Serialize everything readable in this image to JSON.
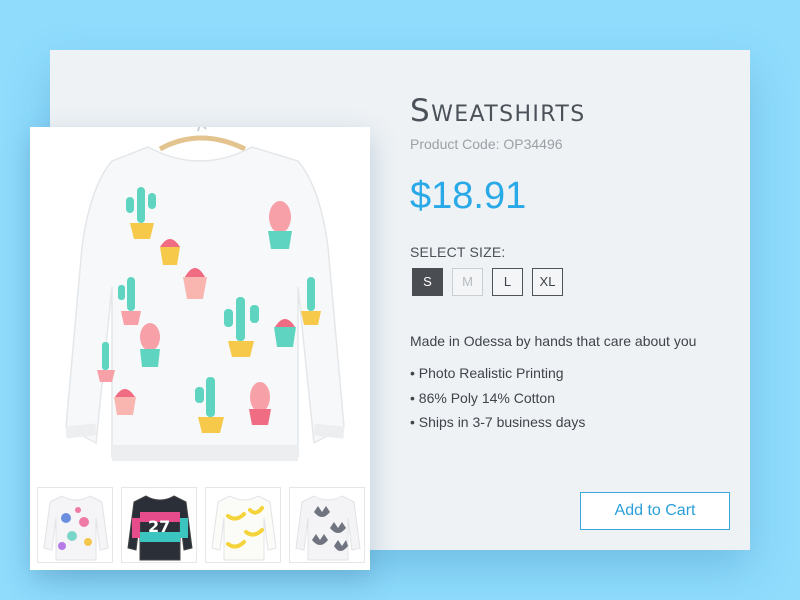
{
  "product": {
    "title": "Sweatshirts",
    "code": "Product Code: OP34496",
    "price": "$18.91",
    "size_label": "SELECT SIZE:",
    "sizes": [
      {
        "label": "S",
        "state": "selected"
      },
      {
        "label": "M",
        "state": "disabled"
      },
      {
        "label": "L",
        "state": "available"
      },
      {
        "label": "XL",
        "state": "available"
      }
    ],
    "description": "Made in Odessa by hands that care about you",
    "features": [
      "• Photo Realistic Printing",
      "• 86% Poly 14% Cotton",
      "• Ships in 3-7 business days"
    ],
    "add_to_cart_label": "Add to Cart"
  },
  "gallery": {
    "main_image": "cactus-print-sweatshirt-image",
    "thumbnails": [
      "owl-print-sweatshirt-thumbnail",
      "number-27-print-sweatshirt-thumbnail",
      "banana-print-sweatshirt-thumbnail",
      "cat-print-sweatshirt-thumbnail"
    ]
  },
  "colors": {
    "background": "#8fdcfd",
    "card": "#eef2f5",
    "accent": "#29a9e7",
    "text": "#3e444a",
    "muted": "#9aa1a6"
  }
}
